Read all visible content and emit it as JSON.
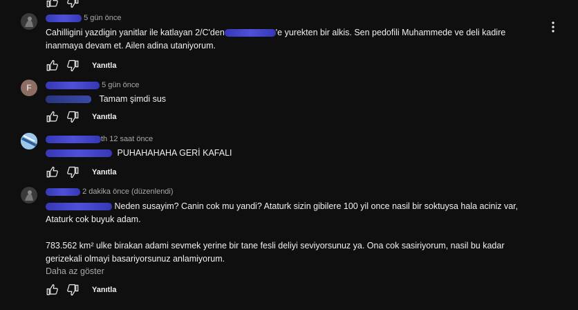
{
  "comments": [
    {
      "time": "5 gün önce",
      "text_pre": "Cahilligini yazdigin yanitlar ile katlayan 2/C'den",
      "text_post": "'e yurekten bir alkis. Sen pedofili Muhammede ve deli kadire inanmaya devam et. Ailen adina utaniyorum.",
      "reply": "Yanıtla"
    },
    {
      "avatar_letter": "F",
      "time": "5 gün önce",
      "text": "Tamam şimdi sus",
      "reply": "Yanıtla"
    },
    {
      "time": "12 saat önce",
      "name_suffix": "th",
      "text": "PUHAHAHAHA GERİ KAFALI",
      "reply": "Yanıtla"
    },
    {
      "time": "2 dakika önce (düzenlendi)",
      "text_line1": "Neden susayim? Canin cok mu yandi? Ataturk sizin gibilere 100 yil once nasil bir soktuysa hala aciniz var,",
      "text_line2": "Ataturk cok buyuk adam.",
      "text_para2_line1": "783.562 km² ulke birakan adami sevmek yerine bir tane fesli deliyi seviyorsunuz ya. Ona cok sasiriyorum, nasil bu kadar",
      "text_para2_line2": "gerizekali olmayi basariyorsunuz anlamiyorum.",
      "show_less": "Daha az göster",
      "reply": "Yanıtla"
    }
  ],
  "icons": {
    "like": "thumb-up-icon",
    "dislike": "thumb-down-icon",
    "more": "more-vert-icon"
  }
}
